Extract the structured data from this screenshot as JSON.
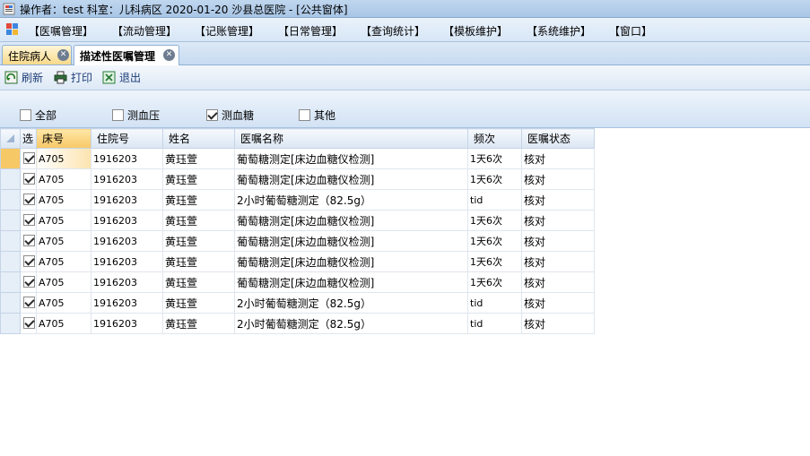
{
  "window": {
    "title": "操作者：test  科室：儿科病区  2020-01-20  沙县总医院 - [公共窗体]"
  },
  "menu": {
    "items": [
      "【医嘱管理】",
      "【流动管理】",
      "【记账管理】",
      "【日常管理】",
      "【查询统计】",
      "【模板维护】",
      "【系统维护】",
      "【窗口】"
    ]
  },
  "tabs": [
    {
      "label": "住院病人"
    },
    {
      "label": "描述性医嘱管理"
    }
  ],
  "toolbar": {
    "refresh": "刷新",
    "print": "打印",
    "exit": "退出"
  },
  "filters": [
    {
      "label": "全部",
      "checked": false
    },
    {
      "label": "测血压",
      "checked": false
    },
    {
      "label": "测血糖",
      "checked": true
    },
    {
      "label": "其他",
      "checked": false
    }
  ],
  "grid": {
    "columns": [
      "选",
      "床号",
      "住院号",
      "姓名",
      "医嘱名称",
      "频次",
      "医嘱状态"
    ],
    "rows": [
      {
        "checked": true,
        "bed": "A705",
        "inpatient_no": "1916203",
        "name": "黄珏萱",
        "order": "葡萄糖测定[床边血糖仪检测]",
        "freq": "1天6次",
        "status": "核对"
      },
      {
        "checked": true,
        "bed": "A705",
        "inpatient_no": "1916203",
        "name": "黄珏萱",
        "order": "葡萄糖测定[床边血糖仪检测]",
        "freq": "1天6次",
        "status": "核对"
      },
      {
        "checked": true,
        "bed": "A705",
        "inpatient_no": "1916203",
        "name": "黄珏萱",
        "order": "2小时葡萄糖测定（82.5g）",
        "freq": "tid",
        "status": "核对"
      },
      {
        "checked": true,
        "bed": "A705",
        "inpatient_no": "1916203",
        "name": "黄珏萱",
        "order": "葡萄糖测定[床边血糖仪检测]",
        "freq": "1天6次",
        "status": "核对"
      },
      {
        "checked": true,
        "bed": "A705",
        "inpatient_no": "1916203",
        "name": "黄珏萱",
        "order": "葡萄糖测定[床边血糖仪检测]",
        "freq": "1天6次",
        "status": "核对"
      },
      {
        "checked": true,
        "bed": "A705",
        "inpatient_no": "1916203",
        "name": "黄珏萱",
        "order": "葡萄糖测定[床边血糖仪检测]",
        "freq": "1天6次",
        "status": "核对"
      },
      {
        "checked": true,
        "bed": "A705",
        "inpatient_no": "1916203",
        "name": "黄珏萱",
        "order": "葡萄糖测定[床边血糖仪检测]",
        "freq": "1天6次",
        "status": "核对"
      },
      {
        "checked": true,
        "bed": "A705",
        "inpatient_no": "1916203",
        "name": "黄珏萱",
        "order": "2小时葡萄糖测定（82.5g）",
        "freq": "tid",
        "status": "核对"
      },
      {
        "checked": true,
        "bed": "A705",
        "inpatient_no": "1916203",
        "name": "黄珏萱",
        "order": "2小时葡萄糖测定（82.5g）",
        "freq": "tid",
        "status": "核对"
      }
    ]
  }
}
